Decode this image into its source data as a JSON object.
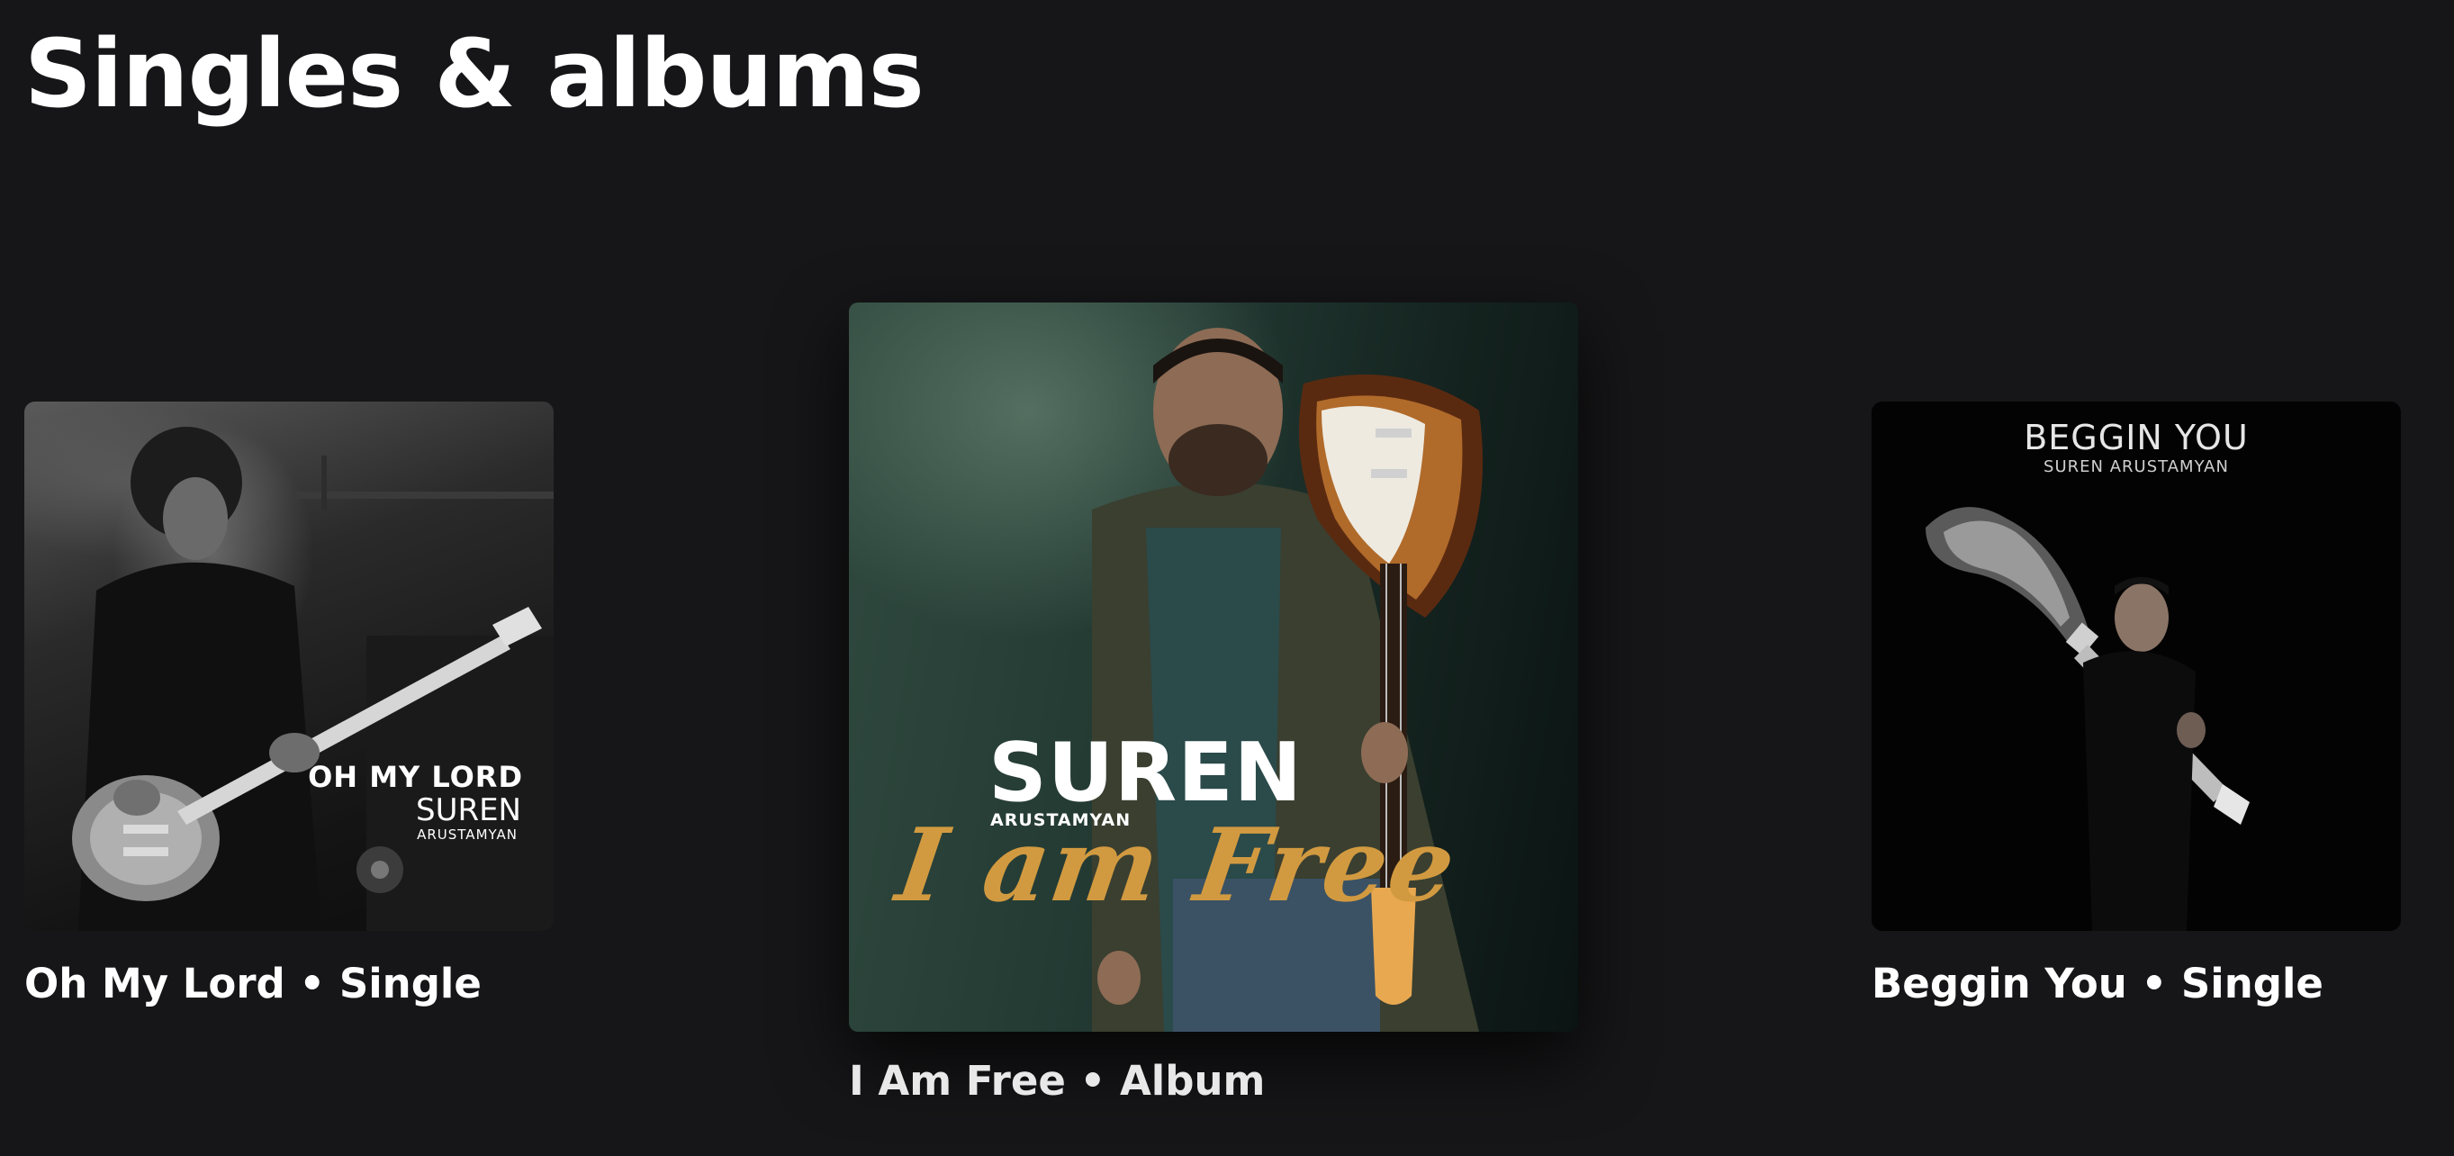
{
  "section": {
    "title": "Singles & albums"
  },
  "releases": [
    {
      "label": "Oh My Lord • Single",
      "cover_text": {
        "title": "OH MY LORD",
        "artist": "SUREN",
        "artist_surname": "ARUSTAMYAN"
      }
    },
    {
      "label": "I Am Free • Album",
      "cover_text": {
        "artist": "SUREN",
        "artist_surname": "ARUSTAMYAN",
        "title": "I am Free"
      }
    },
    {
      "label": "Beggin You • Single",
      "cover_text": {
        "title": "BEGGIN YOU",
        "artist": "SUREN ARUSTAMYAN"
      }
    }
  ],
  "colors": {
    "background": "#161618",
    "text": "#ffffff",
    "album_title_accent": "#d29a40"
  }
}
